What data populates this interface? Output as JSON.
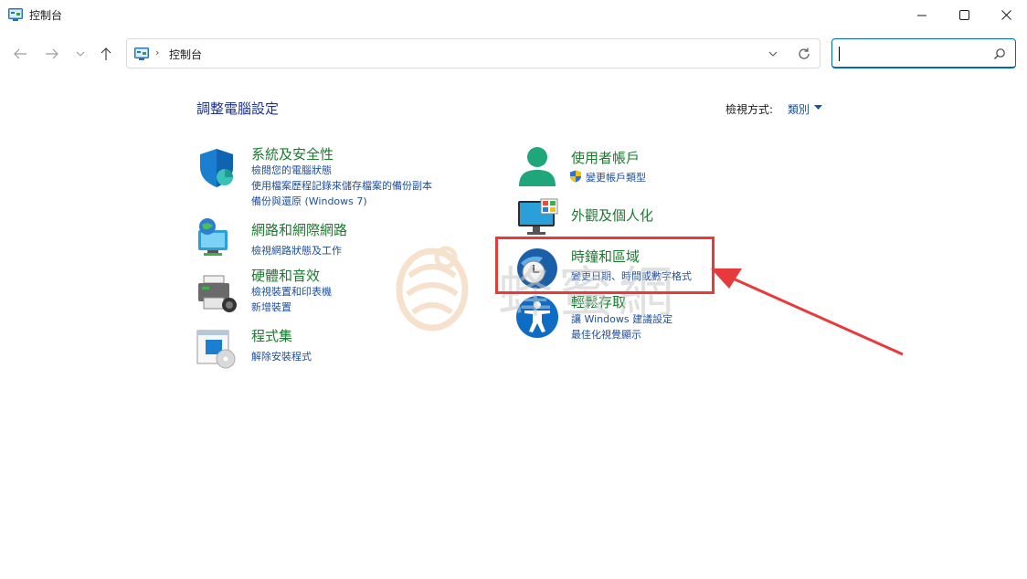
{
  "window": {
    "title": "控制台"
  },
  "addressbar": {
    "separator": "›",
    "crumb": "控制台"
  },
  "search": {
    "value": "",
    "placeholder": ""
  },
  "main": {
    "title": "調整電腦設定",
    "view_by_label": "檢視方式:",
    "view_by_value": "類別"
  },
  "categories_left": [
    {
      "title": "系統及安全性",
      "links": [
        "檢閱您的電腦狀態",
        "使用檔案歷程記錄來儲存檔案的備份副本",
        "備份與還原 (Windows 7)"
      ]
    },
    {
      "title": "網路和網際網路",
      "links": [
        "檢視網路狀態及工作"
      ]
    },
    {
      "title": "硬體和音效",
      "links": [
        "檢視裝置和印表機",
        "新增裝置"
      ]
    },
    {
      "title": "程式集",
      "links": [
        "解除安裝程式"
      ]
    }
  ],
  "categories_right": [
    {
      "title": "使用者帳戶",
      "links": [
        "變更帳戶類型"
      ]
    },
    {
      "title": "外觀及個人化",
      "links": []
    },
    {
      "title": "時鐘和區域",
      "links": [
        "變更日期、時間或數字格式"
      ]
    },
    {
      "title": "輕鬆存取",
      "links": [
        "讓 Windows 建議設定",
        "最佳化視覺顯示"
      ]
    }
  ],
  "watermark": {
    "text": "蜂蜜網"
  },
  "colors": {
    "category_title": "#1a7a2e",
    "link": "#1e4f9c",
    "page_title": "#1e3287",
    "highlight": "#e8393c",
    "accent": "#0067c0"
  }
}
